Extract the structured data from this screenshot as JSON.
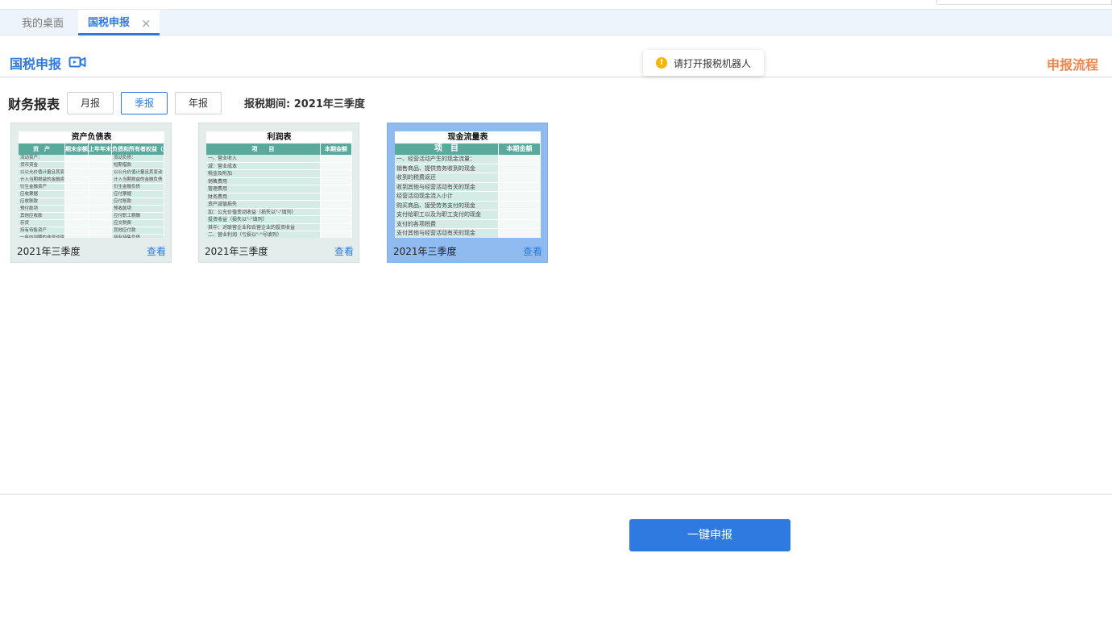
{
  "tabs": {
    "desktop": "我的桌面",
    "active": "国税申报",
    "close_glyph": "×"
  },
  "header": {
    "title": "国税申报",
    "flow_link": "申报流程"
  },
  "toast": {
    "icon_glyph": "!",
    "message": "请打开报税机器人"
  },
  "reports": {
    "section_title": "财务报表",
    "period_buttons": {
      "month": "月报",
      "quarter": "季报",
      "year": "年报"
    },
    "selected_period": "季报",
    "period_label": "报税期间: 2021年三季度",
    "cards": [
      {
        "title": "资产负债表",
        "columns": [
          "资　产",
          "期末余额",
          "上年年末余额",
          "负债和所有者权益（或股东权益）"
        ],
        "rows": [
          [
            "流动资产：",
            "",
            "",
            "流动负债："
          ],
          [
            "货币资金",
            "",
            "",
            "短期借款"
          ],
          [
            "以公允价值计量且其变动",
            "",
            "",
            "以公允价值计量且其变动"
          ],
          [
            "计入当期损益的金融资产",
            "",
            "",
            "计入当期损益的金融负债"
          ],
          [
            "衍生金融资产",
            "",
            "",
            "衍生金融负债"
          ],
          [
            "应收票据",
            "",
            "",
            "应付票据"
          ],
          [
            "应收账款",
            "",
            "",
            "应付账款"
          ],
          [
            "预付款项",
            "",
            "",
            "预收款项"
          ],
          [
            "其他应收款",
            "",
            "",
            "应付职工薪酬"
          ],
          [
            "存货",
            "",
            "",
            "应交税费"
          ],
          [
            "持有待售资产",
            "",
            "",
            "其他应付款"
          ],
          [
            "一年内到期的非流动资产",
            "",
            "",
            "持有待售负债"
          ],
          [
            "其他流动资产",
            "",
            "",
            "一年内到期的非流动负债"
          ],
          [
            "流动资产合计",
            "",
            "",
            "其他流动负债"
          ],
          [
            "非流动资产：",
            "",
            "",
            "流动负债合计"
          ],
          [
            "可供出售金融资产",
            "",
            "",
            "非流动负债："
          ]
        ],
        "period": "2021年三季度",
        "view_label": "查看"
      },
      {
        "title": "利润表",
        "columns": [
          "项　　目",
          "本期金额"
        ],
        "rows": [
          [
            "一、营业收入",
            ""
          ],
          [
            "减：营业成本",
            ""
          ],
          [
            "税金及附加",
            ""
          ],
          [
            "销售费用",
            ""
          ],
          [
            "管理费用",
            ""
          ],
          [
            "财务费用",
            ""
          ],
          [
            "资产减值损失",
            ""
          ],
          [
            "加：公允价值变动收益（损失以\"-\"填列）",
            ""
          ],
          [
            "投资收益（损失以\"-\"填列）",
            ""
          ],
          [
            "其中：对联营企业和合营企业的投资收益",
            ""
          ],
          [
            "二、营业利润（亏损以\"-\"号填列）",
            ""
          ]
        ],
        "period": "2021年三季度",
        "view_label": "查看"
      },
      {
        "title": "现金流量表",
        "columns": [
          "项　目",
          "本期金额"
        ],
        "rows": [
          [
            "一、经营活动产生的现金流量：",
            ""
          ],
          [
            "销售商品、提供劳务收到的现金",
            ""
          ],
          [
            "收到的税费返还",
            ""
          ],
          [
            "收到其他与经营活动有关的现金",
            ""
          ],
          [
            "经营活动现金流入小计",
            ""
          ],
          [
            "购买商品、接受劳务支付的现金",
            ""
          ],
          [
            "支付给职工以及为职工支付的现金",
            ""
          ],
          [
            "支付的各项税费",
            ""
          ],
          [
            "支付其他与经营活动有关的现金",
            ""
          ]
        ],
        "period": "2021年三季度",
        "view_label": "查看"
      }
    ]
  },
  "footer": {
    "submit_label": "一键申报"
  },
  "colors": {
    "accent": "#2f7ae0",
    "flow_link": "#f0874e",
    "toast_icon": "#f5b60a",
    "table_header": "#5aa99d",
    "selected_card": "#8fbbf0"
  }
}
